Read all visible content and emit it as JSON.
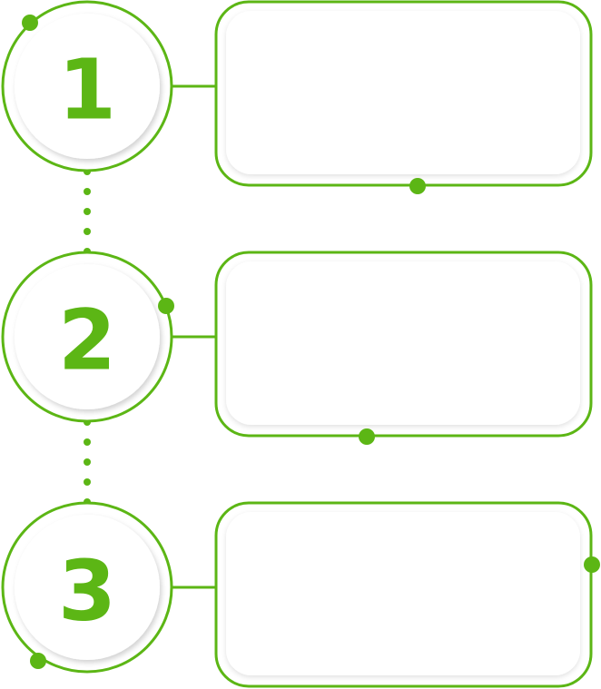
{
  "colors": {
    "accent": "#5cb615",
    "inner_circle": "#ffffff",
    "card_fill": "#ffffff",
    "shadow": "#d9d9d9",
    "background": "#ffffff"
  },
  "steps": [
    {
      "number": "1"
    },
    {
      "number": "2"
    },
    {
      "number": "3"
    }
  ]
}
